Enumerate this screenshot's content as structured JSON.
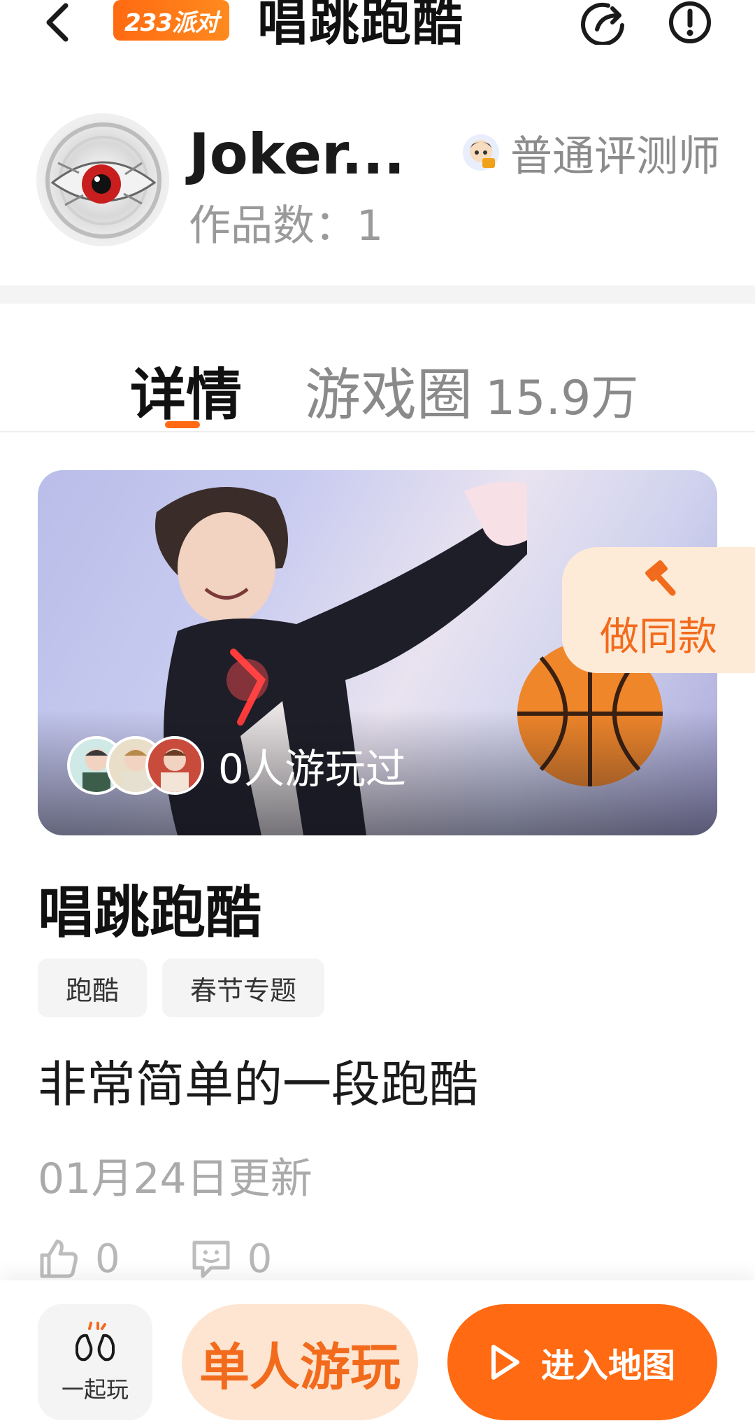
{
  "header": {
    "brand_badge": "233派对",
    "title": "唱跳跑酷",
    "back_icon": "chevron-left-icon",
    "share_icon": "share-icon",
    "report_icon": "alert-circle-icon"
  },
  "author": {
    "name": "Joker...",
    "works_count": "作品数：1",
    "reviewer_label": "普通评测师"
  },
  "tabs": [
    {
      "label": "详情",
      "active": true
    },
    {
      "label": "游戏圈",
      "count": "15.9万",
      "active": false
    }
  ],
  "cover": {
    "played_text": "0人游玩过",
    "make_same_label": "做同款"
  },
  "game": {
    "title": "唱跳跑酷",
    "tags": [
      "跑酷",
      "春节专题"
    ],
    "description": "非常简单的一段跑酷",
    "update_time": "01月24日更新",
    "likes": "0",
    "comments": "0"
  },
  "bottom_bar": {
    "play_together_label": "一起玩",
    "solo_play_label": "单人游玩",
    "enter_map_label": "进入地图"
  },
  "colors": {
    "accent": "#ff6a12",
    "accent_light": "#fde5d1",
    "muted_text": "#9a9a9a"
  }
}
